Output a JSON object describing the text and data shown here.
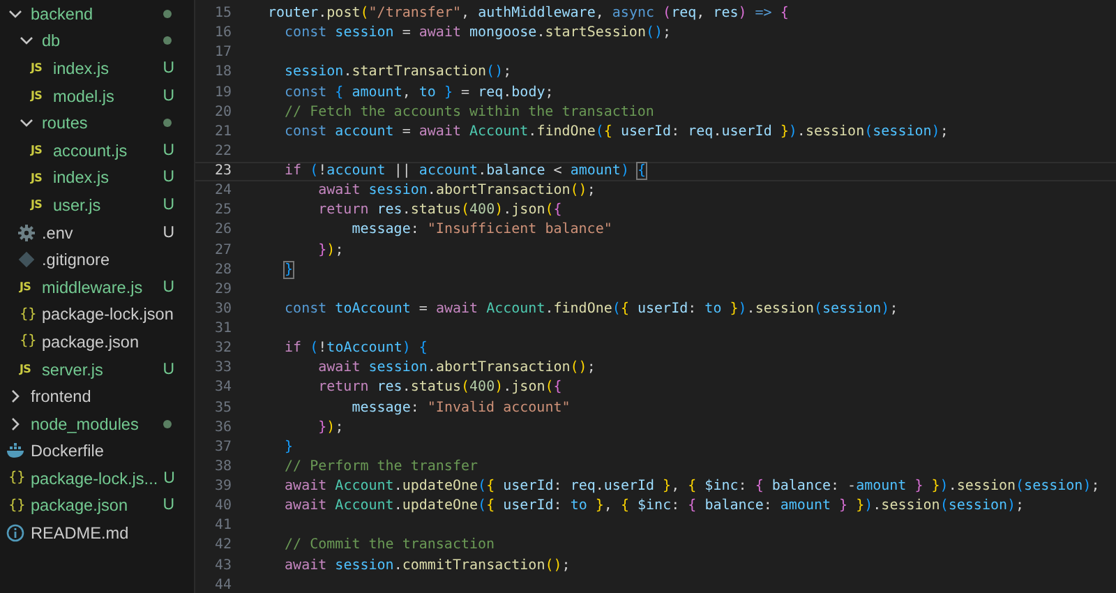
{
  "explorer": {
    "items": [
      {
        "name": "backend",
        "kind": "folder",
        "expanded": true,
        "untracked": true,
        "dot": true,
        "children": [
          {
            "name": "db",
            "kind": "folder",
            "expanded": true,
            "untracked": true,
            "dot": true,
            "children": [
              {
                "name": "index.js",
                "kind": "js",
                "icon": "JS",
                "untracked": true,
                "dot": false,
                "badge": "U"
              },
              {
                "name": "model.js",
                "kind": "js",
                "icon": "JS",
                "untracked": true,
                "dot": false,
                "badge": "U"
              }
            ]
          },
          {
            "name": "routes",
            "kind": "folder",
            "expanded": true,
            "untracked": true,
            "dot": true,
            "children": [
              {
                "name": "account.js",
                "kind": "js",
                "icon": "JS",
                "untracked": true,
                "dot": false,
                "badge": "U"
              },
              {
                "name": "index.js",
                "kind": "js",
                "icon": "JS",
                "untracked": true,
                "dot": false,
                "badge": "U"
              },
              {
                "name": "user.js",
                "kind": "js",
                "icon": "JS",
                "untracked": true,
                "dot": false,
                "badge": "U"
              }
            ]
          },
          {
            "name": ".env",
            "kind": "env",
            "untracked": false,
            "dot": false,
            "badge": "U"
          },
          {
            "name": ".gitignore",
            "kind": "git",
            "untracked": false,
            "dot": false
          },
          {
            "name": "middleware.js",
            "kind": "js",
            "icon": "JS",
            "untracked": true,
            "dot": false,
            "badge": "U"
          },
          {
            "name": "package-lock.json",
            "kind": "json",
            "icon": "{}",
            "untracked": false,
            "dot": false
          },
          {
            "name": "package.json",
            "kind": "json",
            "icon": "{}",
            "untracked": false,
            "dot": false
          },
          {
            "name": "server.js",
            "kind": "js",
            "icon": "JS",
            "untracked": true,
            "dot": false,
            "badge": "U"
          }
        ]
      },
      {
        "name": "frontend",
        "kind": "folder",
        "expanded": false,
        "untracked": false,
        "dot": false
      },
      {
        "name": "node_modules",
        "kind": "folder",
        "expanded": false,
        "untracked": true,
        "dot": true
      },
      {
        "name": "Dockerfile",
        "kind": "docker",
        "untracked": false,
        "dot": false
      },
      {
        "name": "package-lock.js...",
        "kind": "json",
        "icon": "{}",
        "untracked": true,
        "dot": false,
        "badge": "U"
      },
      {
        "name": "package.json",
        "kind": "json",
        "icon": "{}",
        "untracked": true,
        "dot": false,
        "badge": "U"
      },
      {
        "name": "README.md",
        "kind": "readme",
        "untracked": false,
        "dot": false
      }
    ]
  },
  "editor": {
    "lines": [
      {
        "number": "15",
        "current": false,
        "tokens": [
          {
            "text": "router",
            "kind": "var"
          },
          {
            "text": ".",
            "kind": "p"
          },
          {
            "text": "post",
            "kind": "fn"
          },
          {
            "text": "(",
            "kind": "b1"
          },
          {
            "text": "\"/transfer\"",
            "kind": "str"
          },
          {
            "text": ", ",
            "kind": "p"
          },
          {
            "text": "authMiddleware",
            "kind": "var"
          },
          {
            "text": ", ",
            "kind": "p"
          },
          {
            "text": "async",
            "kind": "kw"
          },
          {
            "text": " (",
            "kind": "b2"
          },
          {
            "text": "req",
            "kind": "var"
          },
          {
            "text": ", ",
            "kind": "p"
          },
          {
            "text": "res",
            "kind": "var"
          },
          {
            "text": ")",
            "kind": "b2"
          },
          {
            "text": " =>",
            "kind": "kw"
          },
          {
            "text": " {",
            "kind": "b2"
          }
        ]
      },
      {
        "number": "16",
        "current": false,
        "tokens": [
          {
            "text": "  const",
            "kind": "kw"
          },
          {
            "text": " session",
            "kind": "const"
          },
          {
            "text": " = ",
            "kind": "p"
          },
          {
            "text": "await",
            "kind": "ctl"
          },
          {
            "text": " mongoose",
            "kind": "var"
          },
          {
            "text": ".",
            "kind": "p"
          },
          {
            "text": "startSession",
            "kind": "fn"
          },
          {
            "text": "()",
            "kind": "b3"
          },
          {
            "text": ";",
            "kind": "p"
          }
        ]
      },
      {
        "number": "17",
        "current": false
      },
      {
        "number": "18",
        "current": false,
        "tokens": [
          {
            "text": "  session",
            "kind": "const"
          },
          {
            "text": ".",
            "kind": "p"
          },
          {
            "text": "startTransaction",
            "kind": "fn"
          },
          {
            "text": "()",
            "kind": "b3"
          },
          {
            "text": ";",
            "kind": "p"
          }
        ]
      },
      {
        "number": "19",
        "current": false,
        "tokens": [
          {
            "text": "  const",
            "kind": "kw"
          },
          {
            "text": " {",
            "kind": "b3"
          },
          {
            "text": " amount",
            "kind": "const"
          },
          {
            "text": ", ",
            "kind": "p"
          },
          {
            "text": "to",
            "kind": "const"
          },
          {
            "text": " }",
            "kind": "b3"
          },
          {
            "text": " = ",
            "kind": "p"
          },
          {
            "text": "req",
            "kind": "var"
          },
          {
            "text": ".",
            "kind": "p"
          },
          {
            "text": "body",
            "kind": "var"
          },
          {
            "text": ";",
            "kind": "p"
          }
        ]
      },
      {
        "number": "20",
        "current": false,
        "tokens": [
          {
            "text": "  // Fetch the accounts within the transaction",
            "kind": "com"
          }
        ]
      },
      {
        "number": "21",
        "current": false,
        "tokens": [
          {
            "text": "  const",
            "kind": "kw"
          },
          {
            "text": " account",
            "kind": "const"
          },
          {
            "text": " = ",
            "kind": "p"
          },
          {
            "text": "await",
            "kind": "ctl"
          },
          {
            "text": " Account",
            "kind": "cls"
          },
          {
            "text": ".",
            "kind": "p"
          },
          {
            "text": "findOne",
            "kind": "fn"
          },
          {
            "text": "(",
            "kind": "b3"
          },
          {
            "text": "{",
            "kind": "b1"
          },
          {
            "text": " userId",
            "kind": "var"
          },
          {
            "text": ": ",
            "kind": "p"
          },
          {
            "text": "req",
            "kind": "var"
          },
          {
            "text": ".",
            "kind": "p"
          },
          {
            "text": "userId",
            "kind": "var"
          },
          {
            "text": " }",
            "kind": "b1"
          },
          {
            "text": ")",
            "kind": "b3"
          },
          {
            "text": ".",
            "kind": "p"
          },
          {
            "text": "session",
            "kind": "fn"
          },
          {
            "text": "(",
            "kind": "b3"
          },
          {
            "text": "session",
            "kind": "const"
          },
          {
            "text": ")",
            "kind": "b3"
          },
          {
            "text": ";",
            "kind": "p"
          }
        ]
      },
      {
        "number": "22",
        "current": false
      },
      {
        "number": "23",
        "current": true,
        "tokens": [
          {
            "text": "  if",
            "kind": "ctl"
          },
          {
            "text": " (",
            "kind": "b3"
          },
          {
            "text": "!",
            "kind": "p"
          },
          {
            "text": "account",
            "kind": "const"
          },
          {
            "text": " || ",
            "kind": "p"
          },
          {
            "text": "account",
            "kind": "const"
          },
          {
            "text": ".",
            "kind": "p"
          },
          {
            "text": "balance",
            "kind": "var"
          },
          {
            "text": " < ",
            "kind": "p"
          },
          {
            "text": "amount",
            "kind": "const"
          },
          {
            "text": ")",
            "kind": "b3"
          },
          {
            "text": " {",
            "kind": "match"
          }
        ]
      },
      {
        "number": "24",
        "current": false,
        "tokens": [
          {
            "text": "      await",
            "kind": "ctl"
          },
          {
            "text": " session",
            "kind": "const"
          },
          {
            "text": ".",
            "kind": "p"
          },
          {
            "text": "abortTransaction",
            "kind": "fn"
          },
          {
            "text": "()",
            "kind": "b1"
          },
          {
            "text": ";",
            "kind": "p"
          }
        ]
      },
      {
        "number": "25",
        "current": false,
        "tokens": [
          {
            "text": "      return",
            "kind": "ctl"
          },
          {
            "text": " res",
            "kind": "var"
          },
          {
            "text": ".",
            "kind": "p"
          },
          {
            "text": "status",
            "kind": "fn"
          },
          {
            "text": "(",
            "kind": "b1"
          },
          {
            "text": "400",
            "kind": "num"
          },
          {
            "text": ")",
            "kind": "b1"
          },
          {
            "text": ".",
            "kind": "p"
          },
          {
            "text": "json",
            "kind": "fn"
          },
          {
            "text": "(",
            "kind": "b1"
          },
          {
            "text": "{",
            "kind": "b2"
          }
        ]
      },
      {
        "number": "26",
        "current": false,
        "tokens": [
          {
            "text": "          message",
            "kind": "var"
          },
          {
            "text": ": ",
            "kind": "p"
          },
          {
            "text": "\"Insufficient balance\"",
            "kind": "str"
          }
        ]
      },
      {
        "number": "27",
        "current": false,
        "tokens": [
          {
            "text": "      }",
            "kind": "b2"
          },
          {
            "text": ")",
            "kind": "b1"
          },
          {
            "text": ";",
            "kind": "p"
          }
        ]
      },
      {
        "number": "28",
        "current": false,
        "tokens": [
          {
            "text": "  }",
            "kind": "match"
          }
        ]
      },
      {
        "number": "29",
        "current": false
      },
      {
        "number": "30",
        "current": false,
        "tokens": [
          {
            "text": "  const",
            "kind": "kw"
          },
          {
            "text": " toAccount",
            "kind": "const"
          },
          {
            "text": " = ",
            "kind": "p"
          },
          {
            "text": "await",
            "kind": "ctl"
          },
          {
            "text": " Account",
            "kind": "cls"
          },
          {
            "text": ".",
            "kind": "p"
          },
          {
            "text": "findOne",
            "kind": "fn"
          },
          {
            "text": "(",
            "kind": "b3"
          },
          {
            "text": "{",
            "kind": "b1"
          },
          {
            "text": " userId",
            "kind": "var"
          },
          {
            "text": ": ",
            "kind": "p"
          },
          {
            "text": "to",
            "kind": "const"
          },
          {
            "text": " }",
            "kind": "b1"
          },
          {
            "text": ")",
            "kind": "b3"
          },
          {
            "text": ".",
            "kind": "p"
          },
          {
            "text": "session",
            "kind": "fn"
          },
          {
            "text": "(",
            "kind": "b3"
          },
          {
            "text": "session",
            "kind": "const"
          },
          {
            "text": ")",
            "kind": "b3"
          },
          {
            "text": ";",
            "kind": "p"
          }
        ]
      },
      {
        "number": "31",
        "current": false
      },
      {
        "number": "32",
        "current": false,
        "tokens": [
          {
            "text": "  if",
            "kind": "ctl"
          },
          {
            "text": " (",
            "kind": "b3"
          },
          {
            "text": "!",
            "kind": "p"
          },
          {
            "text": "toAccount",
            "kind": "const"
          },
          {
            "text": ")",
            "kind": "b3"
          },
          {
            "text": " {",
            "kind": "b3"
          }
        ]
      },
      {
        "number": "33",
        "current": false,
        "tokens": [
          {
            "text": "      await",
            "kind": "ctl"
          },
          {
            "text": " session",
            "kind": "const"
          },
          {
            "text": ".",
            "kind": "p"
          },
          {
            "text": "abortTransaction",
            "kind": "fn"
          },
          {
            "text": "()",
            "kind": "b1"
          },
          {
            "text": ";",
            "kind": "p"
          }
        ]
      },
      {
        "number": "34",
        "current": false,
        "tokens": [
          {
            "text": "      return",
            "kind": "ctl"
          },
          {
            "text": " res",
            "kind": "var"
          },
          {
            "text": ".",
            "kind": "p"
          },
          {
            "text": "status",
            "kind": "fn"
          },
          {
            "text": "(",
            "kind": "b1"
          },
          {
            "text": "400",
            "kind": "num"
          },
          {
            "text": ")",
            "kind": "b1"
          },
          {
            "text": ".",
            "kind": "p"
          },
          {
            "text": "json",
            "kind": "fn"
          },
          {
            "text": "(",
            "kind": "b1"
          },
          {
            "text": "{",
            "kind": "b2"
          }
        ]
      },
      {
        "number": "35",
        "current": false,
        "tokens": [
          {
            "text": "          message",
            "kind": "var"
          },
          {
            "text": ": ",
            "kind": "p"
          },
          {
            "text": "\"Invalid account\"",
            "kind": "str"
          }
        ]
      },
      {
        "number": "36",
        "current": false,
        "tokens": [
          {
            "text": "      }",
            "kind": "b2"
          },
          {
            "text": ")",
            "kind": "b1"
          },
          {
            "text": ";",
            "kind": "p"
          }
        ]
      },
      {
        "number": "37",
        "current": false,
        "tokens": [
          {
            "text": "  }",
            "kind": "b3"
          }
        ]
      },
      {
        "number": "38",
        "current": false,
        "tokens": [
          {
            "text": "  // Perform the transfer",
            "kind": "com"
          }
        ]
      },
      {
        "number": "39",
        "current": false,
        "tokens": [
          {
            "text": "  await",
            "kind": "ctl"
          },
          {
            "text": " Account",
            "kind": "cls"
          },
          {
            "text": ".",
            "kind": "p"
          },
          {
            "text": "updateOne",
            "kind": "fn"
          },
          {
            "text": "(",
            "kind": "b3"
          },
          {
            "text": "{",
            "kind": "b1"
          },
          {
            "text": " userId",
            "kind": "var"
          },
          {
            "text": ": ",
            "kind": "p"
          },
          {
            "text": "req",
            "kind": "var"
          },
          {
            "text": ".",
            "kind": "p"
          },
          {
            "text": "userId",
            "kind": "var"
          },
          {
            "text": " }",
            "kind": "b1"
          },
          {
            "text": ", ",
            "kind": "p"
          },
          {
            "text": "{",
            "kind": "b1"
          },
          {
            "text": " $inc",
            "kind": "var"
          },
          {
            "text": ": ",
            "kind": "p"
          },
          {
            "text": "{",
            "kind": "b2"
          },
          {
            "text": " balance",
            "kind": "var"
          },
          {
            "text": ": -",
            "kind": "p"
          },
          {
            "text": "amount",
            "kind": "const"
          },
          {
            "text": " }",
            "kind": "b2"
          },
          {
            "text": " }",
            "kind": "b1"
          },
          {
            "text": ")",
            "kind": "b3"
          },
          {
            "text": ".",
            "kind": "p"
          },
          {
            "text": "session",
            "kind": "fn"
          },
          {
            "text": "(",
            "kind": "b3"
          },
          {
            "text": "session",
            "kind": "const"
          },
          {
            "text": ")",
            "kind": "b3"
          },
          {
            "text": ";",
            "kind": "p"
          }
        ]
      },
      {
        "number": "40",
        "current": false,
        "tokens": [
          {
            "text": "  await",
            "kind": "ctl"
          },
          {
            "text": " Account",
            "kind": "cls"
          },
          {
            "text": ".",
            "kind": "p"
          },
          {
            "text": "updateOne",
            "kind": "fn"
          },
          {
            "text": "(",
            "kind": "b3"
          },
          {
            "text": "{",
            "kind": "b1"
          },
          {
            "text": " userId",
            "kind": "var"
          },
          {
            "text": ": ",
            "kind": "p"
          },
          {
            "text": "to",
            "kind": "const"
          },
          {
            "text": " }",
            "kind": "b1"
          },
          {
            "text": ", ",
            "kind": "p"
          },
          {
            "text": "{",
            "kind": "b1"
          },
          {
            "text": " $inc",
            "kind": "var"
          },
          {
            "text": ": ",
            "kind": "p"
          },
          {
            "text": "{",
            "kind": "b2"
          },
          {
            "text": " balance",
            "kind": "var"
          },
          {
            "text": ": ",
            "kind": "p"
          },
          {
            "text": "amount",
            "kind": "const"
          },
          {
            "text": " }",
            "kind": "b2"
          },
          {
            "text": " }",
            "kind": "b1"
          },
          {
            "text": ")",
            "kind": "b3"
          },
          {
            "text": ".",
            "kind": "p"
          },
          {
            "text": "session",
            "kind": "fn"
          },
          {
            "text": "(",
            "kind": "b3"
          },
          {
            "text": "session",
            "kind": "const"
          },
          {
            "text": ")",
            "kind": "b3"
          },
          {
            "text": ";",
            "kind": "p"
          }
        ]
      },
      {
        "number": "41",
        "current": false
      },
      {
        "number": "42",
        "current": false,
        "tokens": [
          {
            "text": "  // Commit the transaction",
            "kind": "com"
          }
        ]
      },
      {
        "number": "43",
        "current": false,
        "tokens": [
          {
            "text": "  await",
            "kind": "ctl"
          },
          {
            "text": " session",
            "kind": "const"
          },
          {
            "text": ".",
            "kind": "p"
          },
          {
            "text": "commitTransaction",
            "kind": "fn"
          },
          {
            "text": "()",
            "kind": "b1"
          },
          {
            "text": ";",
            "kind": "p"
          }
        ]
      },
      {
        "number": "44",
        "current": false
      }
    ]
  }
}
